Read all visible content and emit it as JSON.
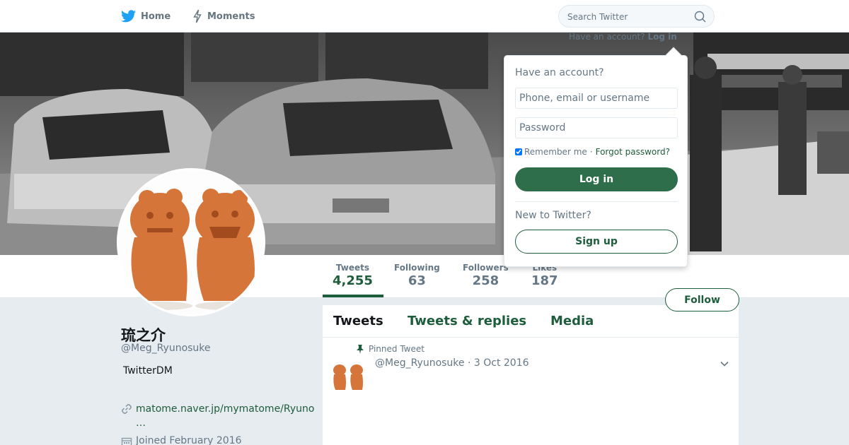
{
  "nav": {
    "home_label": "Home",
    "moments_label": "Moments",
    "search_placeholder": "Search Twitter"
  },
  "login_caption": {
    "prefix": "Have an account?",
    "link": "Log in"
  },
  "profile": {
    "display_name": "琉之介",
    "screen_name": "@Meg_Ryunosuke",
    "bio": "TwitterDM",
    "url_line1": "matome.naver.jp/mymatome/Ryuno",
    "url_line2": "…",
    "joined": "Joined February 2016"
  },
  "stats": [
    {
      "label": "Tweets",
      "value": "4,255"
    },
    {
      "label": "Following",
      "value": "63"
    },
    {
      "label": "Followers",
      "value": "258"
    },
    {
      "label": "Likes",
      "value": "187"
    }
  ],
  "follow_label": "Follow",
  "timeline": {
    "tabs": [
      "Tweets",
      "Tweets & replies",
      "Media"
    ],
    "pinned_label": "Pinned Tweet",
    "tweet_meta": "@Meg_Ryunosuke · 3 Oct 2016"
  },
  "login_dropdown": {
    "title": "Have an account?",
    "username_placeholder": "Phone, email or username",
    "password_placeholder": "Password",
    "remember_label": "Remember me",
    "separator": "·",
    "forgot_label": "Forgot password?",
    "login_label": "Log in",
    "new_title": "New to Twitter?",
    "signup_label": "Sign up"
  },
  "colors": {
    "accent": "#1e5d3b",
    "twitter_blue": "#1da1f2",
    "page_bg": "#e6ecf0"
  },
  "icons": [
    "twitter-bird-icon",
    "lightning-icon",
    "search-icon",
    "link-icon",
    "calendar-icon",
    "pin-icon",
    "chevron-down-icon"
  ]
}
